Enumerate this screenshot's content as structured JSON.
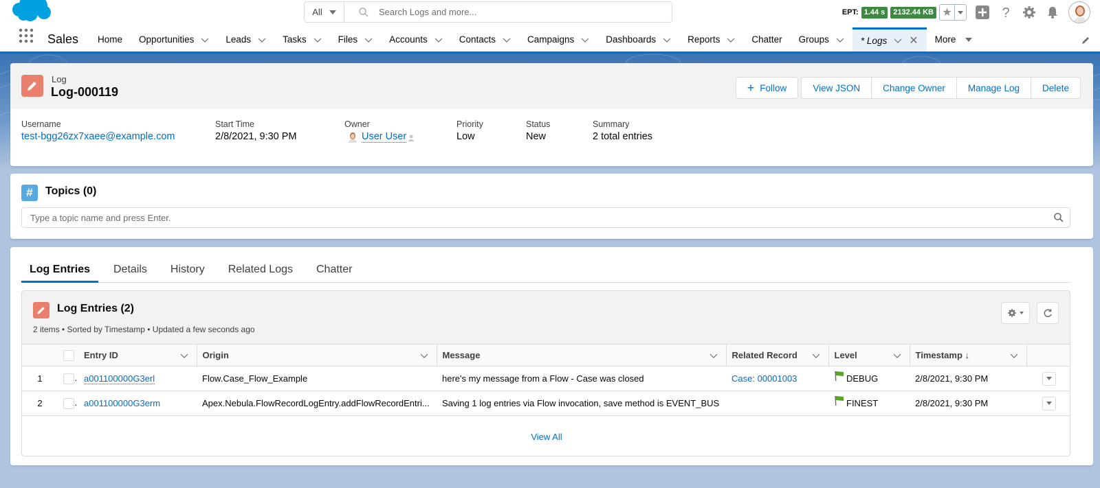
{
  "header": {
    "search_scope": "All",
    "search_placeholder": "Search Logs and more...",
    "ept_label": "EPT:",
    "ept_time": "1.44 s",
    "ept_size": "2132.44 KB",
    "icons": [
      "favorites-star-icon",
      "global-actions-plus-icon",
      "help-icon",
      "setup-gear-icon",
      "notifications-bell-icon",
      "user-avatar"
    ]
  },
  "nav": {
    "app_name": "Sales",
    "items": [
      {
        "label": "Home",
        "has_menu": false
      },
      {
        "label": "Opportunities",
        "has_menu": true
      },
      {
        "label": "Leads",
        "has_menu": true
      },
      {
        "label": "Tasks",
        "has_menu": true
      },
      {
        "label": "Files",
        "has_menu": true
      },
      {
        "label": "Accounts",
        "has_menu": true
      },
      {
        "label": "Contacts",
        "has_menu": true
      },
      {
        "label": "Campaigns",
        "has_menu": true
      },
      {
        "label": "Dashboards",
        "has_menu": true
      },
      {
        "label": "Reports",
        "has_menu": true
      },
      {
        "label": "Chatter",
        "has_menu": false
      },
      {
        "label": "Groups",
        "has_menu": true
      }
    ],
    "active_tab": "* Logs",
    "more_label": "More"
  },
  "record": {
    "object_type": "Log",
    "title": "Log-000119",
    "actions": {
      "follow": "Follow",
      "view_json": "View JSON",
      "change_owner": "Change Owner",
      "manage_log": "Manage Log",
      "delete": "Delete"
    },
    "fields": [
      {
        "label": "Username",
        "value": "test-bgg26zx7xaee@example.com",
        "link": true
      },
      {
        "label": "Start Time",
        "value": "2/8/2021, 9:30 PM",
        "link": false
      },
      {
        "label": "Owner",
        "value": "User User",
        "link": true
      },
      {
        "label": "Priority",
        "value": "Low",
        "link": false
      },
      {
        "label": "Status",
        "value": "New",
        "link": false
      },
      {
        "label": "Summary",
        "value": "2 total entries",
        "link": false
      }
    ]
  },
  "topics": {
    "title": "Topics (0)",
    "placeholder": "Type a topic name and press Enter."
  },
  "tabs": [
    {
      "label": "Log Entries",
      "active": true
    },
    {
      "label": "Details",
      "active": false
    },
    {
      "label": "History",
      "active": false
    },
    {
      "label": "Related Logs",
      "active": false
    },
    {
      "label": "Chatter",
      "active": false
    }
  ],
  "related_list": {
    "title": "Log Entries (2)",
    "subtitle": "2 items • Sorted by Timestamp • Updated a few seconds ago",
    "columns": [
      "Entry ID",
      "Origin",
      "Message",
      "Related Record",
      "Level",
      "Timestamp ↓"
    ],
    "rows": [
      {
        "num": "1",
        "entry_id": "a001100000G3erl",
        "origin": "Flow.Case_Flow_Example",
        "message": "here's my message from a Flow - Case was closed",
        "related_record": "Case: 00001003",
        "level": "DEBUG",
        "timestamp": "2/8/2021, 9:30 PM"
      },
      {
        "num": "2",
        "entry_id": "a001100000G3erm",
        "origin": "Apex.Nebula.FlowRecordLogEntry.addFlowRecordEntri...",
        "message": "Saving 1 log entries via Flow invocation, save method is EVENT_BUS",
        "related_record": "",
        "level": "FINEST",
        "timestamp": "2/8/2021, 9:30 PM"
      }
    ],
    "view_all": "View All"
  },
  "colors": {
    "brand": "#0070d2",
    "link": "#006dcc",
    "log_icon": "#e9806e",
    "topics_icon": "#56aadf",
    "ept_badge": "#3c8a3f",
    "level_flag": "#5aa12e"
  }
}
